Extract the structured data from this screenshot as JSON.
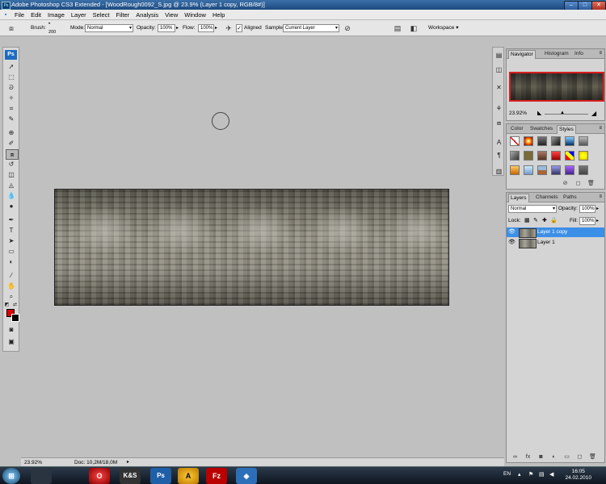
{
  "title_bar": {
    "text": "Adobe Photoshop CS3 Extended - [WoodRough0092_S.jpg @ 23.9% (Layer 1 copy, RGB/8#)]",
    "app_icon": "Ps"
  },
  "window_controls": {
    "minimize": "–",
    "maximize": "□",
    "close": "✕"
  },
  "menu": {
    "items": [
      "File",
      "Edit",
      "Image",
      "Layer",
      "Select",
      "Filter",
      "Analysis",
      "View",
      "Window",
      "Help"
    ]
  },
  "options_bar": {
    "brush_label": "Brush:",
    "brush_size": "200",
    "mode_label": "Mode:",
    "mode_value": "Normal",
    "opacity_label": "Opacity:",
    "opacity_value": "100%",
    "flow_label": "Flow:",
    "flow_value": "100%",
    "aligned_label": "Aligned",
    "sample_label": "Sample:",
    "sample_value": "Current Layer",
    "workspace_label": "Workspace ▾"
  },
  "toolbox": {
    "logo": "Ps",
    "active_tool": "clone-stamp"
  },
  "colors": {
    "foreground": "#e00000",
    "background": "#000000",
    "layer_highlight": "#3c8fe6",
    "navigator_box": "#d81e1e"
  },
  "status_bar": {
    "zoom": "23.92%",
    "doc_info": "Doc: 10,2M/18,0M"
  },
  "navigator_panel": {
    "tabs": [
      "Navigator",
      "Histogram",
      "Info"
    ],
    "zoom": "23.92%"
  },
  "styles_panel": {
    "tabs": [
      "Color",
      "Swatches",
      "Styles"
    ]
  },
  "layers_panel": {
    "tabs": [
      "Layers",
      "Channels",
      "Paths"
    ],
    "blend_mode": "Normal",
    "opacity_label": "Opacity:",
    "opacity_value": "100%",
    "lock_label": "Lock:",
    "fill_label": "Fill:",
    "fill_value": "100%",
    "layers": [
      {
        "name": "Layer 1 copy",
        "active": true
      },
      {
        "name": "Layer 1",
        "active": false
      }
    ]
  },
  "taskbar": {
    "apps": [
      "Windows",
      "Opera",
      "K&S",
      "Ps",
      "Avast",
      "FileZilla",
      "Browser"
    ],
    "language": "EN",
    "time": "16:05",
    "date": "24.02.2010"
  }
}
